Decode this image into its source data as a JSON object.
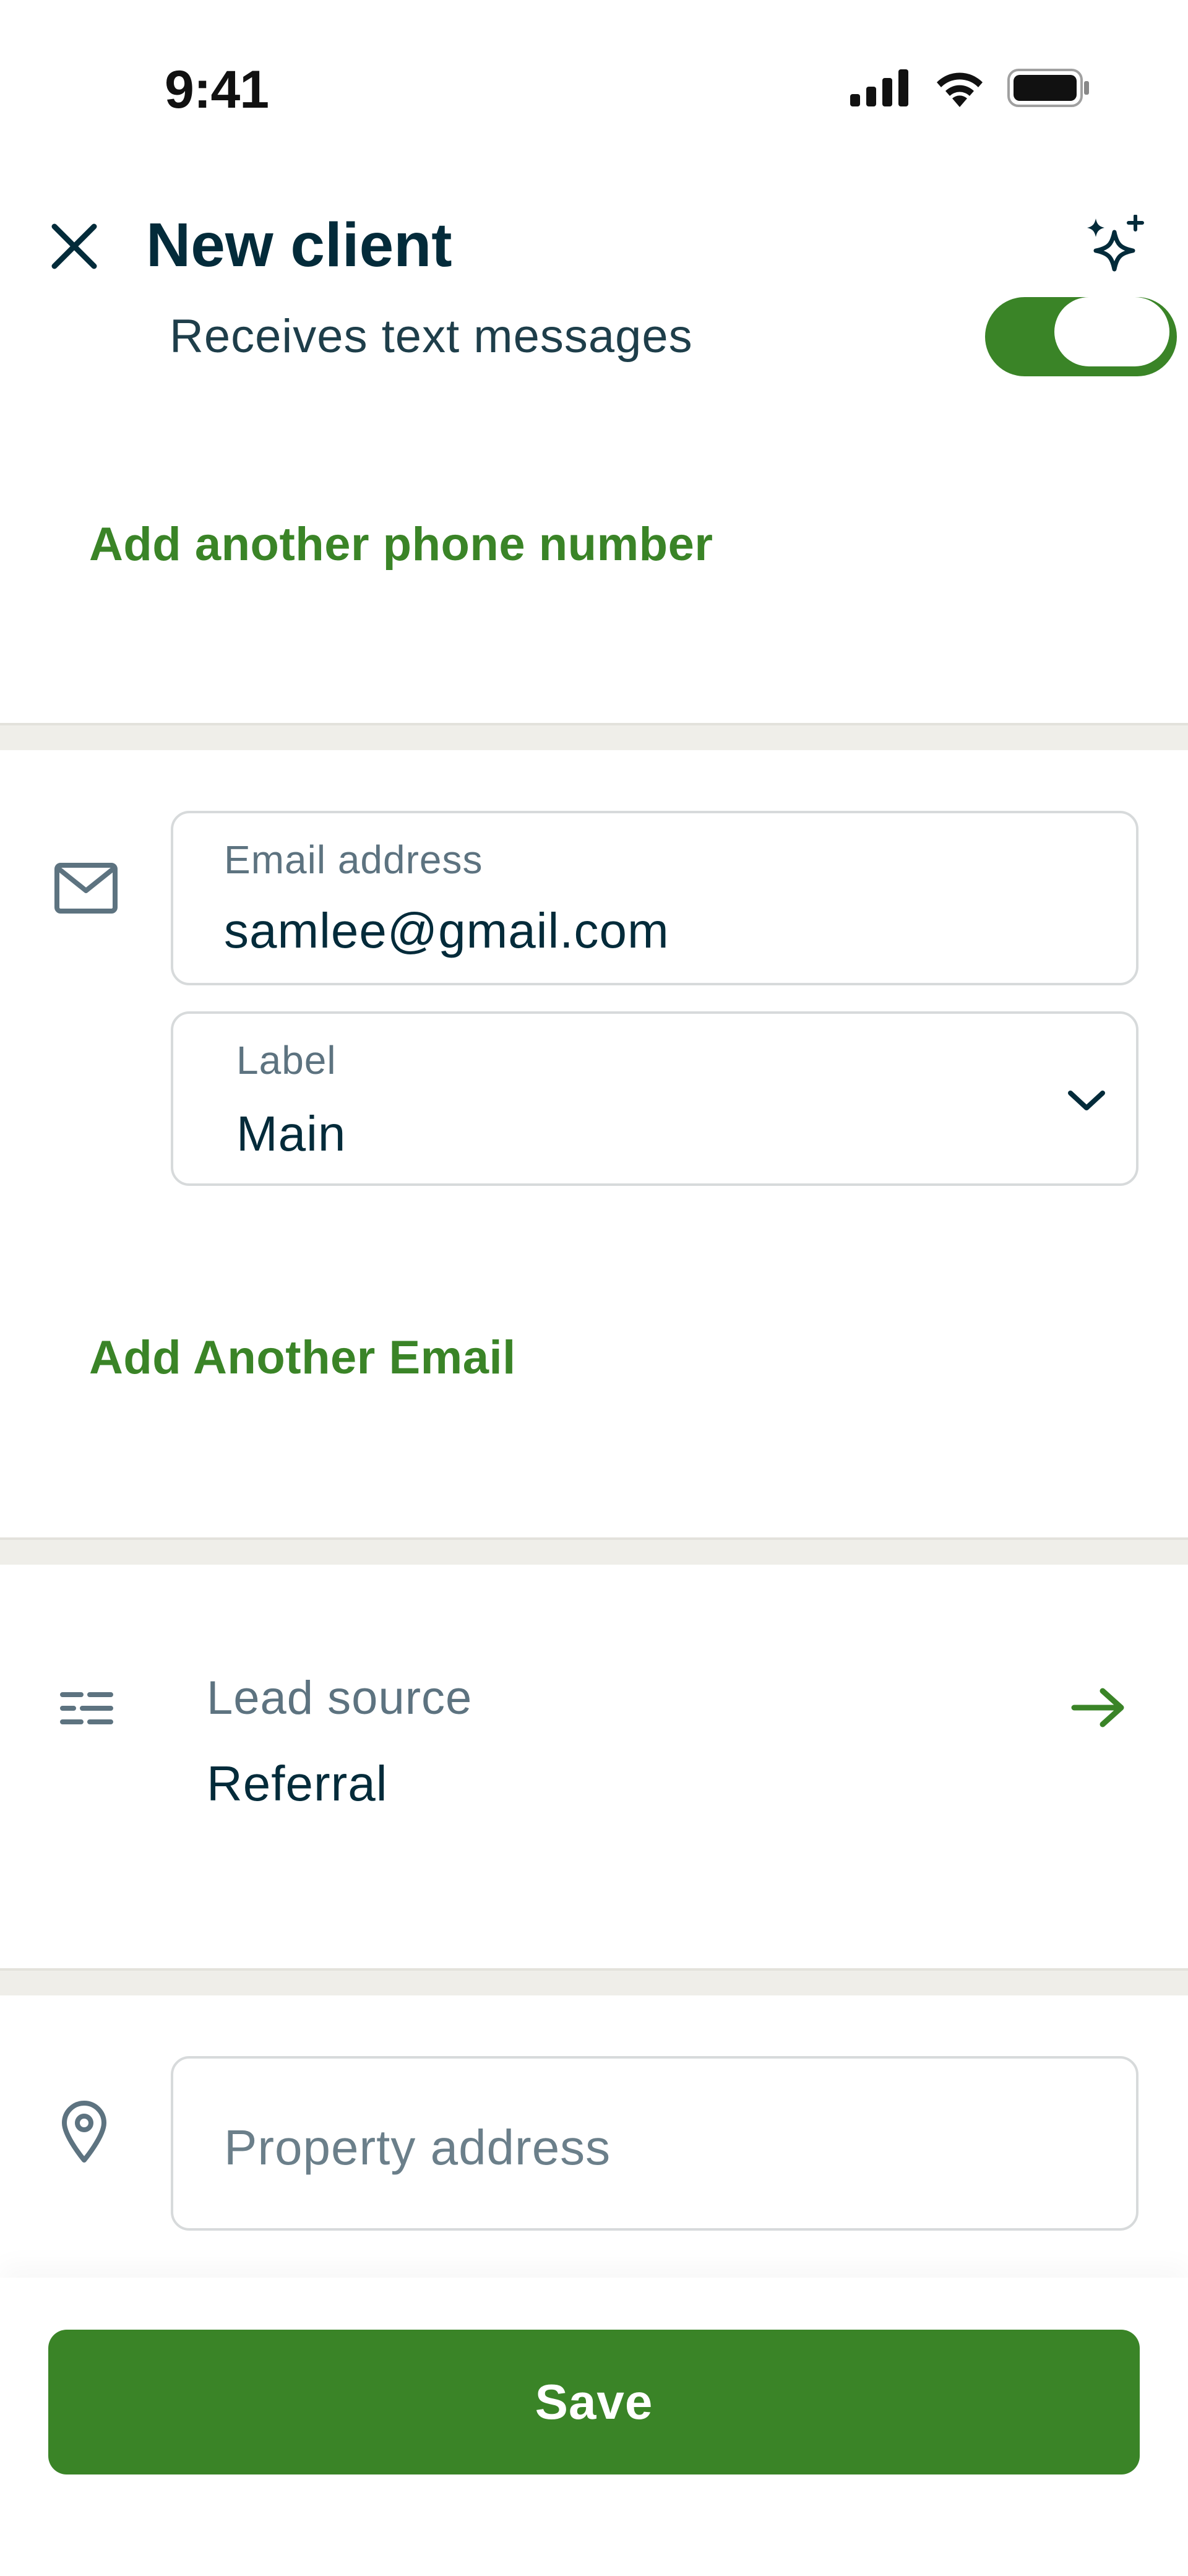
{
  "status_bar": {
    "time": "9:41",
    "icons": [
      "signal-icon",
      "wifi-icon",
      "battery-icon"
    ]
  },
  "header": {
    "title": "New client",
    "close_icon": "close-icon",
    "action_icon": "sparkle-icon"
  },
  "phone_section": {
    "text_messages_label": "Receives text messages",
    "text_messages_enabled": true,
    "add_phone_link": "Add another phone number"
  },
  "email_section": {
    "icon": "envelope-icon",
    "email_field": {
      "label": "Email address",
      "value": "samlee@gmail.com"
    },
    "label_select": {
      "label": "Label",
      "value": "Main"
    },
    "add_email_link": "Add Another Email"
  },
  "lead_source": {
    "icon": "list-icon",
    "label": "Lead source",
    "value": "Referral",
    "arrow_icon": "arrow-right-icon"
  },
  "property": {
    "icon": "location-pin-icon",
    "placeholder": "Property address"
  },
  "footer": {
    "save_label": "Save"
  },
  "colors": {
    "accent": "#3a8427",
    "text": "#032b3a",
    "muted": "#5d7380",
    "divider": "#efeee9"
  }
}
